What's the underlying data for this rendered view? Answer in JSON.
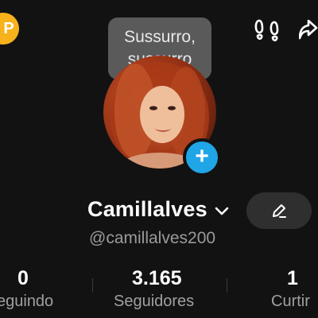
{
  "tooltip": {
    "line1": "Sussurro,",
    "line2": "sussurro"
  },
  "profile": {
    "name": "Camillalves",
    "handle": "@camillalves200"
  },
  "stats": [
    {
      "value": "0",
      "label": "eguindo"
    },
    {
      "value": "3.165",
      "label": "Seguidores"
    },
    {
      "value": "1",
      "label": "Curtir"
    }
  ],
  "icons": {
    "coin": "coin-icon",
    "footprints": "footprints-icon",
    "share": "share-icon",
    "add": "plus-icon",
    "chevron": "chevron-down-icon",
    "edit": "pencil-icon"
  },
  "colors": {
    "background": "#121212",
    "accent_blue": "#20a5e6",
    "coin": "#f7b21c"
  }
}
